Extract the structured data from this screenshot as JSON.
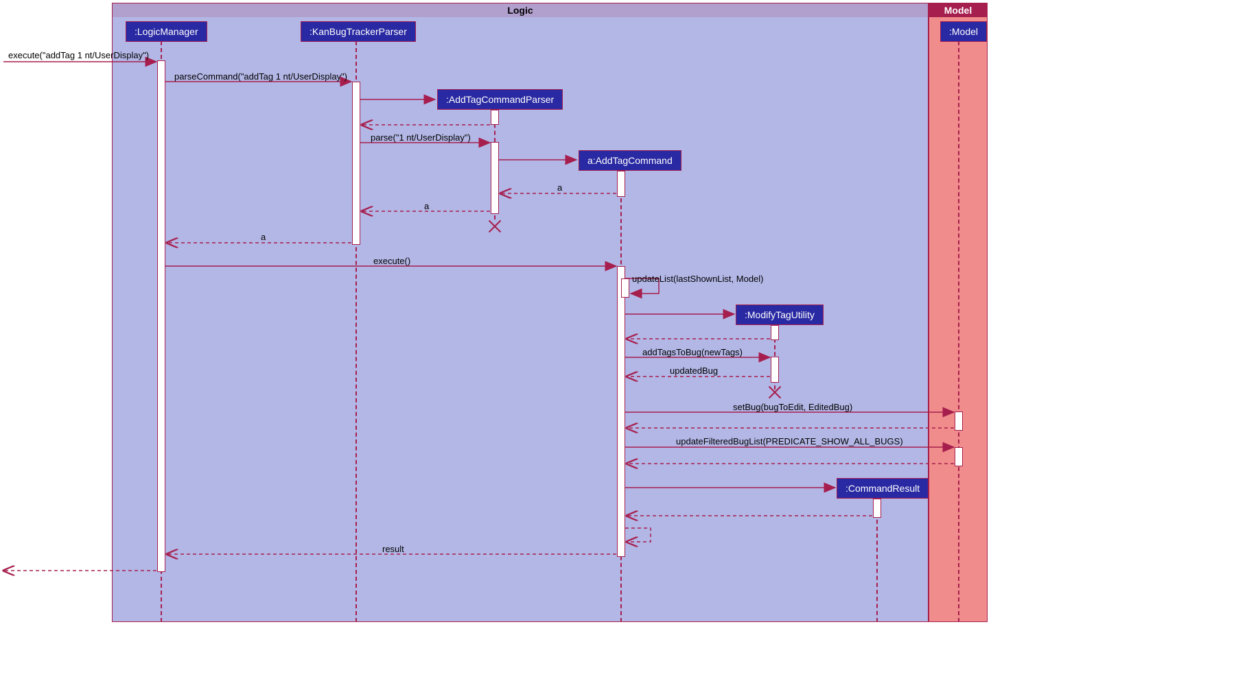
{
  "frames": {
    "logic": "Logic",
    "model": "Model"
  },
  "participants": {
    "logicManager": ":LogicManager",
    "kanBugTrackerParser": ":KanBugTrackerParser",
    "addTagCommandParser": ":AddTagCommandParser",
    "addTagCommand": "a:AddTagCommand",
    "modifyTagUtility": ":ModifyTagUtility",
    "commandResult": ":CommandResult",
    "model": ":Model"
  },
  "messages": {
    "execute1": "execute(\"addTag 1 nt/UserDisplay\")",
    "parseCommand": "parseCommand(\"addTag 1 nt/UserDisplay\")",
    "parse": "parse(\"1 nt/UserDisplay\")",
    "return_a1": "a",
    "return_a2": "a",
    "return_a3": "a",
    "execute2": "execute()",
    "updateList": "updateList(lastShownList, Model)",
    "addTagsToBug": "addTagsToBug(newTags)",
    "updatedBug": "updatedBug",
    "setBug": "setBug(bugToEdit, EditedBug)",
    "updateFilteredBugList": "updateFilteredBugList(PREDICATE_SHOW_ALL_BUGS)",
    "result": "result"
  }
}
